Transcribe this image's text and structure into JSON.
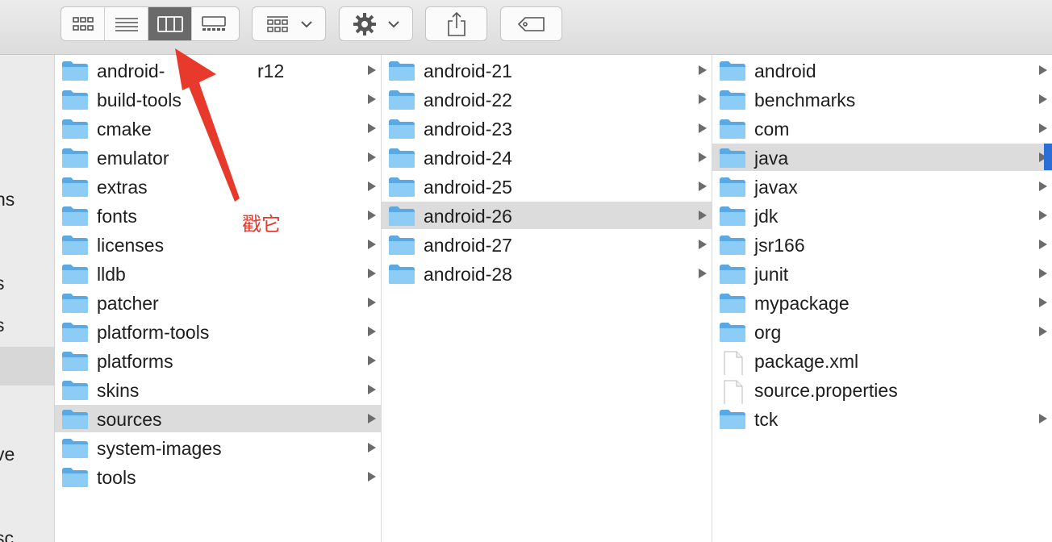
{
  "toolbar": {
    "view_buttons": [
      "icon-view",
      "list-view",
      "column-view",
      "gallery-view"
    ],
    "active_view": "column-view",
    "group_icon": "group-icon",
    "action_icon": "gear-icon",
    "share_icon": "share-icon",
    "tag_icon": "tag-icon"
  },
  "sidebar": {
    "fragments": [
      "ns",
      "s",
      "s",
      "ve",
      "sc"
    ]
  },
  "columns": [
    {
      "items": [
        {
          "name": "android-",
          "name_tail": "r12",
          "type": "folder"
        },
        {
          "name": "build-tools",
          "type": "folder"
        },
        {
          "name": "cmake",
          "type": "folder"
        },
        {
          "name": "emulator",
          "type": "folder"
        },
        {
          "name": "extras",
          "type": "folder"
        },
        {
          "name": "fonts",
          "type": "folder"
        },
        {
          "name": "licenses",
          "type": "folder"
        },
        {
          "name": "lldb",
          "type": "folder"
        },
        {
          "name": "patcher",
          "type": "folder"
        },
        {
          "name": "platform-tools",
          "type": "folder"
        },
        {
          "name": "platforms",
          "type": "folder"
        },
        {
          "name": "skins",
          "type": "folder"
        },
        {
          "name": "sources",
          "type": "folder",
          "selected": true
        },
        {
          "name": "system-images",
          "type": "folder"
        },
        {
          "name": "tools",
          "type": "folder"
        }
      ]
    },
    {
      "items": [
        {
          "name": "android-21",
          "type": "folder"
        },
        {
          "name": "android-22",
          "type": "folder"
        },
        {
          "name": "android-23",
          "type": "folder"
        },
        {
          "name": "android-24",
          "type": "folder"
        },
        {
          "name": "android-25",
          "type": "folder"
        },
        {
          "name": "android-26",
          "type": "folder",
          "selected": true
        },
        {
          "name": "android-27",
          "type": "folder"
        },
        {
          "name": "android-28",
          "type": "folder"
        }
      ]
    },
    {
      "items": [
        {
          "name": "android",
          "type": "folder"
        },
        {
          "name": "benchmarks",
          "type": "folder"
        },
        {
          "name": "com",
          "type": "folder"
        },
        {
          "name": "java",
          "type": "folder",
          "selected": true
        },
        {
          "name": "javax",
          "type": "folder"
        },
        {
          "name": "jdk",
          "type": "folder"
        },
        {
          "name": "jsr166",
          "type": "folder"
        },
        {
          "name": "junit",
          "type": "folder"
        },
        {
          "name": "mypackage",
          "type": "folder"
        },
        {
          "name": "org",
          "type": "folder"
        },
        {
          "name": "package.xml",
          "type": "file"
        },
        {
          "name": "source.properties",
          "type": "file"
        },
        {
          "name": "tck",
          "type": "folder"
        }
      ]
    }
  ],
  "annotation": {
    "text": "戳它",
    "color": "#e83a2c"
  },
  "colors": {
    "folder": "#6fb8ea",
    "selection": "#dcdcdc",
    "scroll_indicator": "#2b6fd6"
  }
}
